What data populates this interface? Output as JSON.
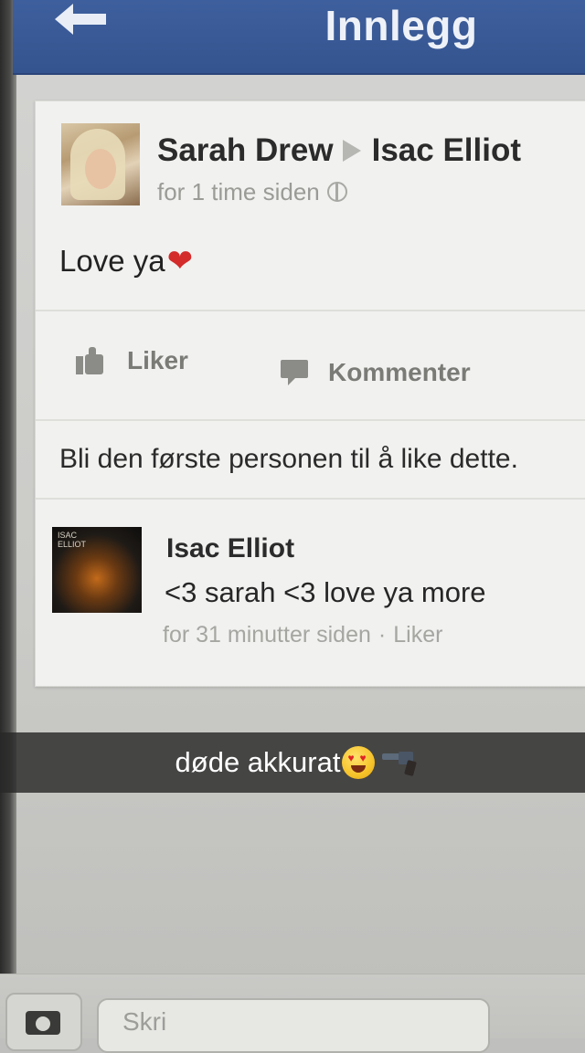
{
  "navbar": {
    "title": "Innlegg",
    "back_icon": "arrow-left-icon"
  },
  "post": {
    "author": "Sarah Drew",
    "target": "Isac Elliot",
    "time": "for 1 time siden",
    "privacy_icon": "globe-icon",
    "text": "Love ya",
    "text_emoji": "heart-icon",
    "actions": {
      "like_label": "Liker",
      "comment_label": "Kommenter"
    },
    "likes_summary": "Bli den første personen til å like dette."
  },
  "comment": {
    "author": "Isac Elliot",
    "avatar_text": "ISAC ELLIOT",
    "text": "<3 sarah <3 love ya more",
    "time": "for 31 minutter siden",
    "separator": "·",
    "like_label": "Liker"
  },
  "snap": {
    "caption": "døde akkurat",
    "emojis": [
      "heart-eyes-emoji",
      "pistol-emoji"
    ]
  },
  "composer": {
    "placeholder_partial": "Skri"
  },
  "colors": {
    "navbar": "#3e5f9d",
    "card_bg": "#f1f1ef",
    "snap_bar": "#282828"
  }
}
